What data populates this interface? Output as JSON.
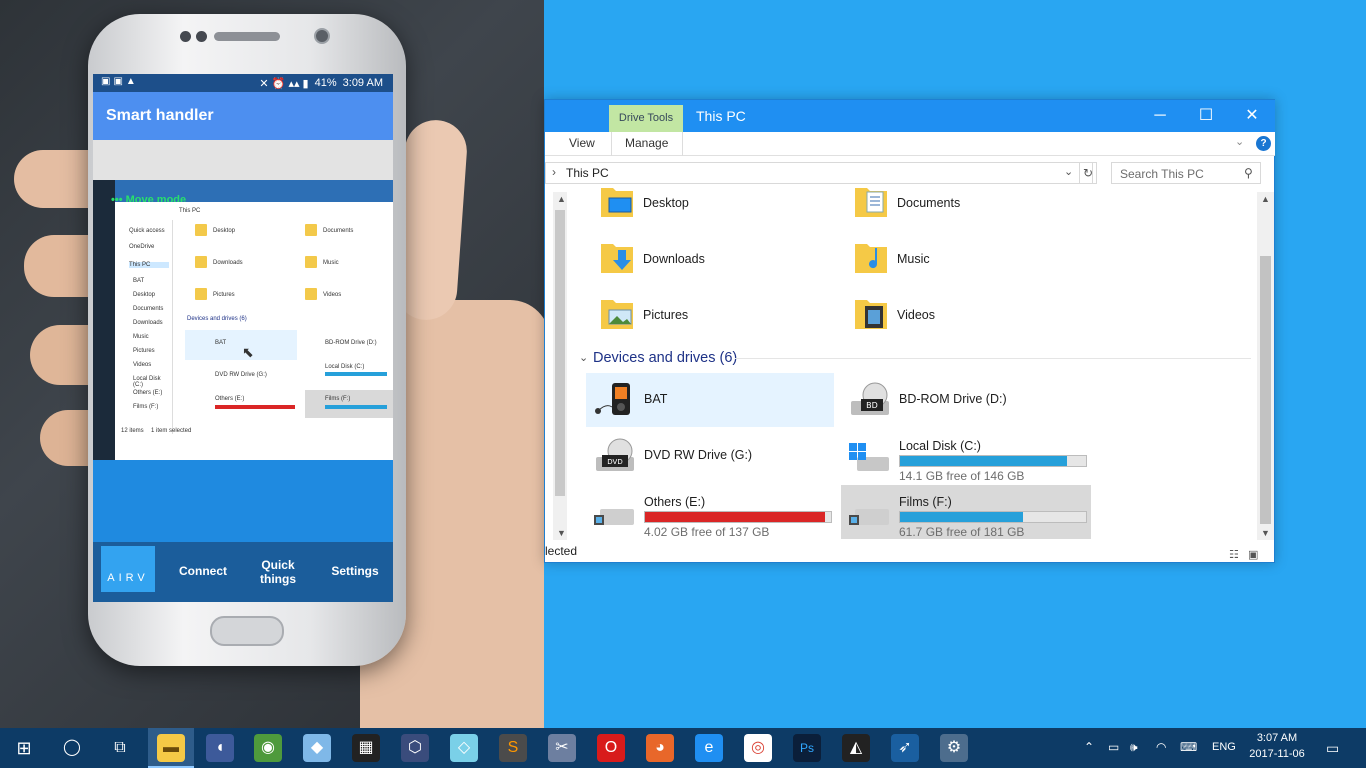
{
  "phone": {
    "status_time": "3:09 AM",
    "status_battery": "41%",
    "app_title": "Smart handler",
    "mirror_mode_label": "Move mode",
    "mirror_address": "This PC",
    "mirror_folders": [
      "Desktop",
      "Documents",
      "Downloads",
      "Music",
      "Pictures",
      "Videos"
    ],
    "mirror_nav": [
      "Quick access",
      "OneDrive",
      "This PC",
      "BAT",
      "Desktop",
      "Documents",
      "Downloads",
      "Music",
      "Pictures",
      "Videos",
      "Local Disk (C:)",
      "Others (E:)",
      "Films (F:)"
    ],
    "mirror_devices_header": "Devices and drives (6)",
    "mirror_drives": [
      "BAT",
      "BD-ROM Drive (D:)",
      "DVD RW Drive (G:)",
      "Local Disk (C:)",
      "Others (E:)",
      "Films (F:)"
    ],
    "mirror_status": "12 items",
    "mirror_status_selected": "1 item selected",
    "nav": {
      "logo_label": "AIRV",
      "connect_label": "Connect",
      "quick_label": "Quick things",
      "settings_label": "Settings"
    }
  },
  "explorer": {
    "context_tab": "Drive Tools",
    "title": "This PC",
    "ribbon_tabs": {
      "view": "View",
      "manage": "Manage"
    },
    "address": "This PC",
    "search_placeholder": "Search This PC",
    "folders": [
      {
        "name": "Desktop",
        "icon": "desktop-folder-icon"
      },
      {
        "name": "Documents",
        "icon": "documents-folder-icon"
      },
      {
        "name": "Downloads",
        "icon": "downloads-folder-icon"
      },
      {
        "name": "Music",
        "icon": "music-folder-icon"
      },
      {
        "name": "Pictures",
        "icon": "pictures-folder-icon"
      },
      {
        "name": "Videos",
        "icon": "videos-folder-icon"
      }
    ],
    "devices_header": "Devices and drives (6)",
    "drives": [
      {
        "name": "BAT",
        "free": "",
        "used_fraction": null
      },
      {
        "name": "BD-ROM Drive (D:)",
        "free": "",
        "used_fraction": null
      },
      {
        "name": "DVD RW Drive (G:)",
        "free": "",
        "used_fraction": null
      },
      {
        "name": "Local Disk (C:)",
        "free": "14.1 GB free of 146 GB",
        "used_fraction": 0.9
      },
      {
        "name": "Others (E:)",
        "free": "4.02 GB free of 137 GB",
        "used_fraction": 0.97
      },
      {
        "name": "Films (F:)",
        "free": "61.7 GB free of 181 GB",
        "used_fraction": 0.66
      }
    ],
    "status_text": "lected",
    "colors": {
      "accent": "#1f8ff2",
      "bar_blue": "#26a0da",
      "bar_red": "#da2626",
      "context_green": "#c2e6a3"
    }
  },
  "taskbar": {
    "time": "3:07 AM",
    "date": "2017-11-06",
    "language": "ENG"
  }
}
